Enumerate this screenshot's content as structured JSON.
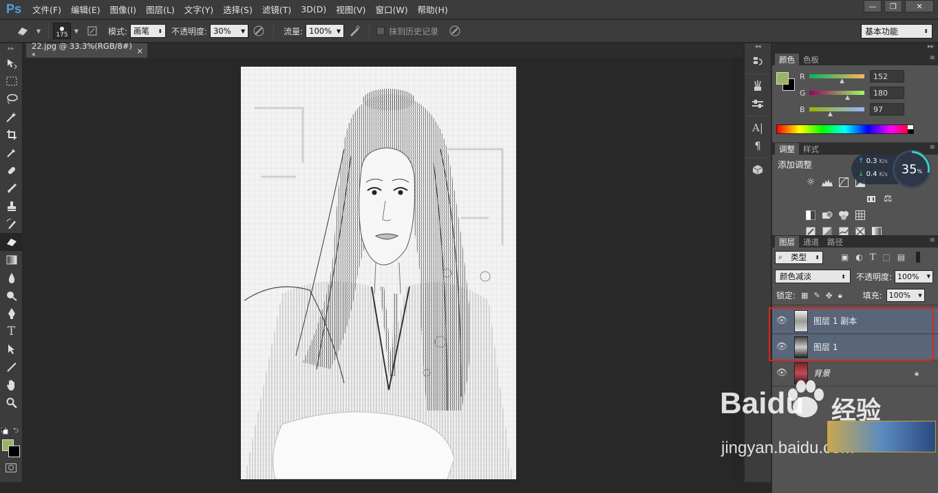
{
  "app": {
    "logo": "Ps"
  },
  "menu": [
    "文件(F)",
    "编辑(E)",
    "图像(I)",
    "图层(L)",
    "文字(Y)",
    "选择(S)",
    "滤镜(T)",
    "3D(D)",
    "视图(V)",
    "窗口(W)",
    "帮助(H)"
  ],
  "window_controls": {
    "minimize": "—",
    "restore": "❐",
    "close": "✕"
  },
  "options": {
    "brush_size": "175",
    "mode_label": "模式:",
    "mode_value": "画笔",
    "opacity_label": "不透明度:",
    "opacity_value": "30%",
    "flow_label": "流量:",
    "flow_value": "100%",
    "history_label": "抹到历史记录",
    "workspace": "基本功能"
  },
  "document": {
    "tab_title": "22.jpg @ 33.3%(RGB/8#) *",
    "close": "×"
  },
  "color_panel": {
    "tabs": [
      "颜色",
      "色板"
    ],
    "r_label": "R",
    "g_label": "G",
    "b_label": "B",
    "r": "152",
    "g": "180",
    "b": "97",
    "fg_color": "#98b461"
  },
  "adjust_panel": {
    "tabs": [
      "调整",
      "样式"
    ],
    "title": "添加调整"
  },
  "net_widget": {
    "up": "0.3",
    "down": "0.4",
    "unit": "K/s",
    "percent": "35",
    "percent_sign": "%"
  },
  "layers_panel": {
    "tabs": [
      "图层",
      "通道",
      "路径"
    ],
    "filter_kind": "类型",
    "blend_mode": "颜色减淡",
    "opacity_label": "不透明度:",
    "opacity_value": "100%",
    "lock_label": "锁定:",
    "fill_label": "填充:",
    "fill_value": "100%",
    "layers": [
      {
        "name": "图层 1 副本",
        "selected": true
      },
      {
        "name": "图层 1",
        "selected": true
      },
      {
        "name": "背景",
        "selected": false,
        "locked": true
      }
    ]
  },
  "watermark": {
    "brand": "Baidu",
    "brand_cn": "经验",
    "url": "jingyan.baidu.com"
  }
}
